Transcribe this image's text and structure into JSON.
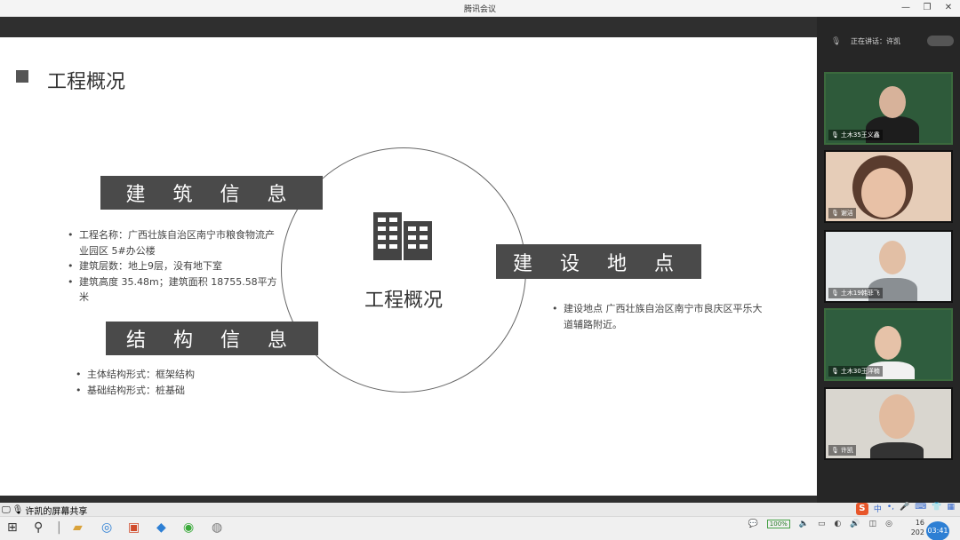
{
  "window": {
    "title": "腾讯会议"
  },
  "slide": {
    "title": "工程概况",
    "center_label": "工程概况",
    "sections": [
      {
        "heading": "建 筑 信 息",
        "items": [
          "工程名称：广西壮族自治区南宁市粮食物流产业园区 5#办公楼",
          "建筑层数：地上9层，没有地下室",
          "建筑高度 35.48m；建筑面积 18755.58平方米"
        ]
      },
      {
        "heading": "结 构 信 息",
        "items": [
          "主体结构形式：框架结构",
          "基础结构形式：桩基础"
        ]
      },
      {
        "heading": "建 设 地 点",
        "items": [
          "建设地点 广西壮族自治区南宁市良庆区平乐大道辅路附近。"
        ]
      }
    ]
  },
  "sidebar": {
    "speaking_label": "正在讲话：许凯",
    "participants": [
      {
        "name": "土木35王义鑫"
      },
      {
        "name": "谢洁"
      },
      {
        "name": "土木19韩菲飞"
      },
      {
        "name": "土木30王洋楠"
      },
      {
        "name": "许凯"
      }
    ]
  },
  "share_bar": {
    "label": "许凯的屏幕共享"
  },
  "taskbar": {
    "battery": "100%",
    "clock_top": "16",
    "clock_bottom": "202",
    "time_bubble": "03:41"
  },
  "colors": {
    "band": "#4a4a4a",
    "accent_blue": "#2d7fd4",
    "sogou": "#e8562a"
  }
}
